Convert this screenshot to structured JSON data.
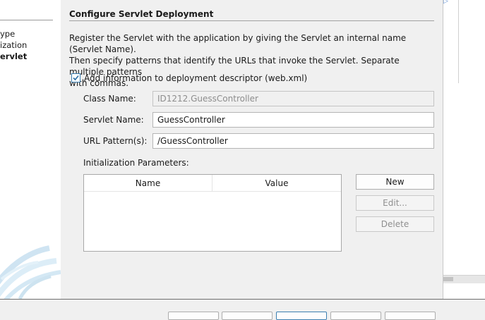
{
  "left_steps": [
    {
      "text": "ype",
      "active": false
    },
    {
      "text": "ization",
      "active": false
    },
    {
      "text": "ervlet",
      "active": true
    }
  ],
  "section": {
    "title": "Configure Servlet Deployment",
    "description": [
      "Register the Servlet with the application by giving the Servlet an internal name (Servlet Name).",
      "Then specify patterns that identify the URLs that invoke the Servlet. Separate multiple patterns",
      "with commas."
    ]
  },
  "deployment_descriptor": {
    "label": "Add information to deployment descriptor (web.xml)",
    "checked": true
  },
  "fields": {
    "class_name": {
      "label": "Class Name:",
      "value": "ID1212.GuessController",
      "disabled": true
    },
    "servlet_name": {
      "label": "Servlet Name:",
      "value": "GuessController"
    },
    "url_pattern": {
      "label": "URL Pattern(s):",
      "value": "/GuessController"
    }
  },
  "init_params": {
    "label": "Initialization Parameters:",
    "columns": [
      "Name",
      "Value"
    ],
    "rows": []
  },
  "buttons": {
    "new": {
      "label": "New",
      "enabled": true
    },
    "edit": {
      "label": "Edit...",
      "enabled": false
    },
    "delete": {
      "label": "Delete",
      "enabled": false
    }
  },
  "colors": {
    "accent": "#3c7fb1",
    "arrow": "#5b8bd0"
  }
}
